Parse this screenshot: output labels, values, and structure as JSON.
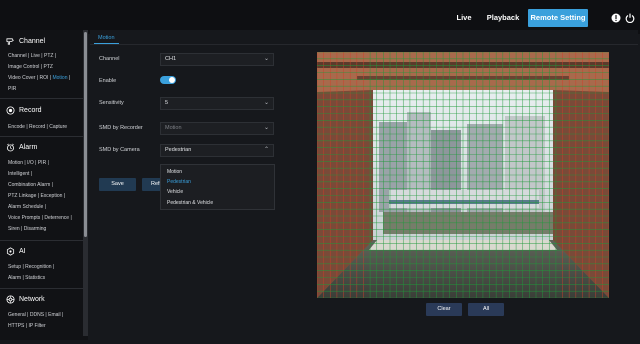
{
  "topnav": {
    "live": "Live",
    "playback": "Playback",
    "remote_setting": "Remote Setting",
    "icons": [
      "info-icon",
      "power-icon"
    ]
  },
  "sidebar": {
    "channel": {
      "title": "Channel",
      "icon": "camera-icon",
      "links": [
        "Channel",
        "Live",
        "PTZ",
        "Image Control",
        "Video Cover",
        "ROI",
        "Motion",
        "PIR"
      ],
      "active": "Motion"
    },
    "record": {
      "title": "Record",
      "icon": "record-icon",
      "links": [
        "Encode",
        "Record",
        "Capture"
      ]
    },
    "alarm": {
      "title": "Alarm",
      "icon": "alarm-icon",
      "links": [
        "Motion",
        "I/O",
        "PIR",
        "Intelligent",
        "Combination Alarm",
        "PTZ Linkage",
        "Exception",
        "Alarm Schedule",
        "Voice Prompts",
        "Deterrence",
        "Siren",
        "Disarming"
      ]
    },
    "ai": {
      "title": "AI",
      "icon": "ai-icon",
      "links": [
        "Setup",
        "Recognition",
        "Alarm",
        "Statistics"
      ]
    },
    "network": {
      "title": "Network",
      "icon": "network-icon",
      "links": [
        "General",
        "DDNS",
        "Email",
        "HTTPS",
        "IP Filter"
      ]
    }
  },
  "tab": {
    "label": "Motion"
  },
  "form": {
    "channel_label": "Channel",
    "channel_value": "CH1",
    "enable_label": "Enable",
    "enable_on": true,
    "sensitivity_label": "Sensitivity",
    "sensitivity_value": "5",
    "smd_recorder_label": "SMD by Recorder",
    "smd_recorder_value": "Motion",
    "smd_camera_label": "SMD by Camera",
    "smd_camera_value": "Pedestrian",
    "save": "Save",
    "refresh_partial": "Refr"
  },
  "dropdown": {
    "options": [
      "Motion",
      "Pedestrian",
      "Vehicle",
      "Pedestrian & Vehicle"
    ],
    "selected": "Pedestrian"
  },
  "video": {
    "clear": "Clear",
    "all": "All",
    "grid_color": "#1f9a3a",
    "detected_color": "#d0402a"
  },
  "colors": {
    "accent": "#3aa0dc",
    "background": "#16181c",
    "sidebar": "#111215"
  }
}
